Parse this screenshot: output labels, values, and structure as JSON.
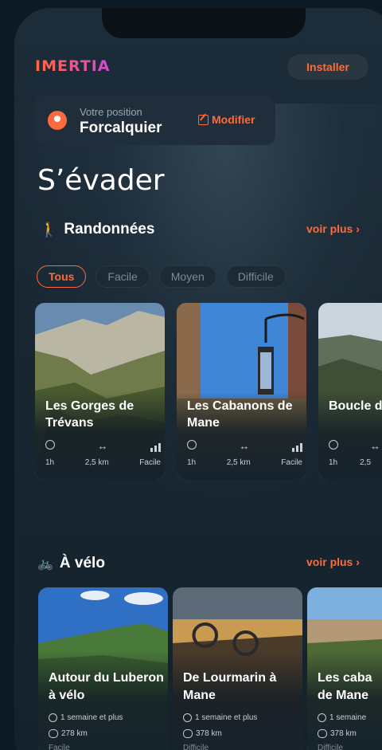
{
  "app": {
    "logo_text": "IMERTIA",
    "install_label": "Installer"
  },
  "location": {
    "label": "Votre position",
    "city": "Forcalquier",
    "edit_label": "Modifier"
  },
  "page_title": "S’évader",
  "hikes": {
    "title": "Randonnées",
    "more_label": "voir plus ›",
    "filters": [
      "Tous",
      "Facile",
      "Moyen",
      "Difficile"
    ],
    "active_filter": "Tous",
    "cards": [
      {
        "title": "Les Gorges de Trévans",
        "duration": "1h",
        "distance": "2,5 km",
        "difficulty": "Facile"
      },
      {
        "title": "Les Cabanons de Mane",
        "duration": "1h",
        "distance": "2,5 km",
        "difficulty": "Facile"
      },
      {
        "title": "Boucle d Mane à",
        "duration": "1h",
        "distance": "2,5",
        "difficulty": ""
      }
    ]
  },
  "bikes": {
    "title": "À vélo",
    "more_label": "voir plus ›",
    "cards": [
      {
        "title": "Autour du Luberon à vélo",
        "duration": "1 semaine et plus",
        "distance": "278 km",
        "difficulty": "Facile"
      },
      {
        "title": "De Lourmarin à Mane",
        "duration": "1 semaine et plus",
        "distance": "378 km",
        "difficulty": "Difficile"
      },
      {
        "title": "Les caba de Mane",
        "duration": "1 semaine",
        "distance": "378 km",
        "difficulty": "Difficile"
      }
    ]
  },
  "colors": {
    "accent": "#ff6a3c",
    "background": "#182732"
  }
}
